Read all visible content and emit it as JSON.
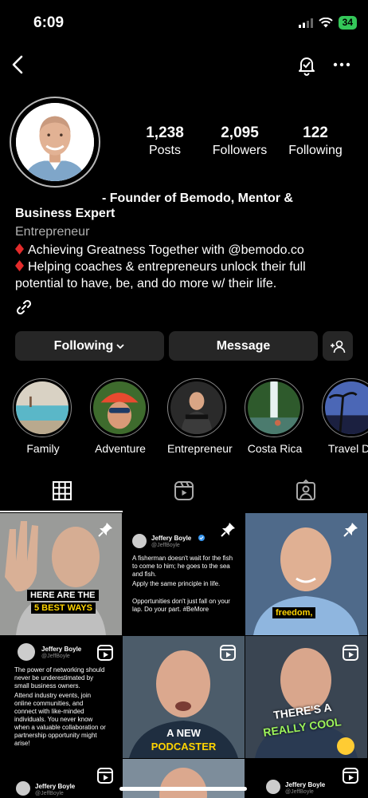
{
  "status_bar": {
    "time": "6:09",
    "battery": "34"
  },
  "bio": {
    "name_line1": "- Founder of Bemodo, Mentor &",
    "name_line2": "Business Expert",
    "category": "Entrepreneur",
    "line1": "Achieving Greatness Together with @bemodo.co",
    "line2": "Helping coaches & entrepreneurs unlock their full",
    "line3": "potential to have, be, and do more w/ their life."
  },
  "stats": [
    {
      "value": "1,238",
      "label": "Posts"
    },
    {
      "value": "2,095",
      "label": "Followers"
    },
    {
      "value": "122",
      "label": "Following"
    }
  ],
  "buttons": {
    "following": "Following",
    "message": "Message"
  },
  "highlights": [
    "Family",
    "Adventure",
    "Entrepreneur",
    "Costa Rica",
    "Travel De"
  ],
  "posts": {
    "p1_caption_a": "HERE ARE THE",
    "p1_caption_b": "5 BEST WAYS",
    "p2_name": "Jeffery Boyle",
    "p2_handle": "@JeffBoyle",
    "p2_text1": "A fisherman doesn't wait for the fish to come to him; he goes to the sea and fish.",
    "p2_text2": "Apply the same principle in life.",
    "p2_text3": "Opportunities don't just fall on your lap. Do your part. #BeMore",
    "p3_caption": "freedom,",
    "p4_name": "Jeffery Boyle",
    "p4_handle": "@JeffBoyle",
    "p4_text1": "The power of networking should never be underestimated by small business owners.",
    "p4_text2": "Attend industry events, join online communities, and connect with like-minded individuals. You never know when a valuable collaboration or partnership opportunity might arise!",
    "p5_caption_a": "A NEW",
    "p5_caption_b": "PODCASTER",
    "p6_caption_a": "THERE'S A",
    "p6_caption_b": "REALLY COOL",
    "p7_name": "Jeffery Boyle",
    "p7_handle": "@JeffBoyle",
    "p9_name": "Jeffery Boyle",
    "p9_handle": "@JeffBoyle"
  },
  "colors": {
    "accent_green": "#34c759",
    "button_bg": "#262626",
    "diamond_red": "#e32b2b",
    "caption_yellow": "#ffd400"
  }
}
